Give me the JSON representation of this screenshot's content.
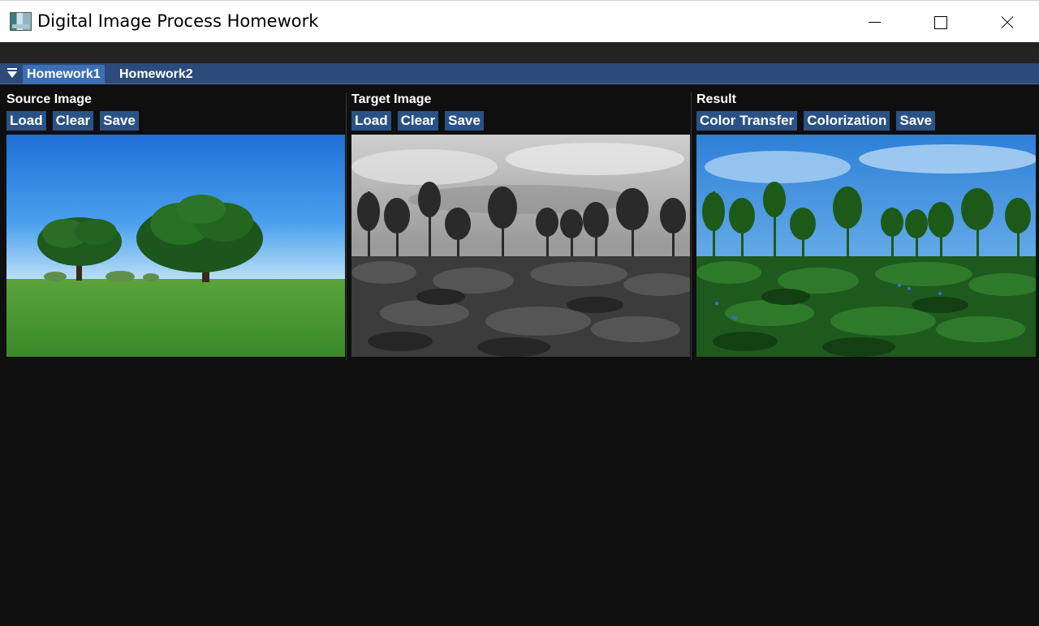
{
  "window": {
    "title": "Digital Image Process Homework"
  },
  "tabs": [
    {
      "label": "Homework1",
      "active": true
    },
    {
      "label": "Homework2",
      "active": false
    }
  ],
  "panels": {
    "source": {
      "title": "Source Image",
      "buttons": [
        "Load",
        "Clear",
        "Save"
      ]
    },
    "target": {
      "title": "Target Image",
      "buttons": [
        "Load",
        "Clear",
        "Save"
      ]
    },
    "result": {
      "title": "Result",
      "buttons": [
        "Color Transfer",
        "Colorization",
        "Save"
      ]
    }
  },
  "colors": {
    "background": "#0f0f0f",
    "tabbar": "#2c4a7a",
    "tab_active": "#3b6fb6",
    "button": "#2a5286"
  }
}
